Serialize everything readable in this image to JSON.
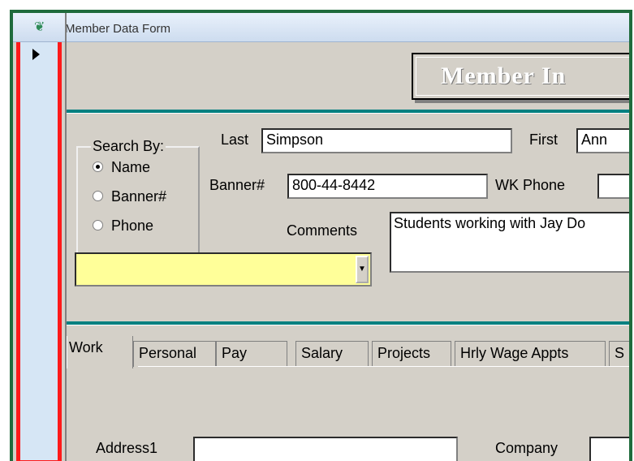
{
  "window": {
    "title": "Member Data Form"
  },
  "header": {
    "title": "Member In"
  },
  "search": {
    "group_label": "Search By:",
    "options": [
      "Name",
      "Banner#",
      "Phone"
    ],
    "selected": "Name",
    "combo_value": ""
  },
  "fields": {
    "last_label": "Last",
    "last_value": "Simpson",
    "first_label": "First",
    "first_value": "Ann",
    "banner_label": "Banner#",
    "banner_value": "800-44-8442",
    "wkphone_label": "WK Phone",
    "wkphone_value": "",
    "comments_label": "Comments",
    "comments_value": "Students working with Jay Do",
    "address1_label": "Address1",
    "address1_value": "",
    "company_label": "Company",
    "company_value": ""
  },
  "tabs": [
    "Work",
    "Personal",
    "Pay",
    "Salary",
    "Projects",
    "Hrly Wage Appts",
    "S"
  ],
  "colors": {
    "teal_rule": "#008080",
    "combo_bg": "#ffff99",
    "selector_highlight": "#ff1a1a",
    "frame": "#1f6b3c"
  }
}
